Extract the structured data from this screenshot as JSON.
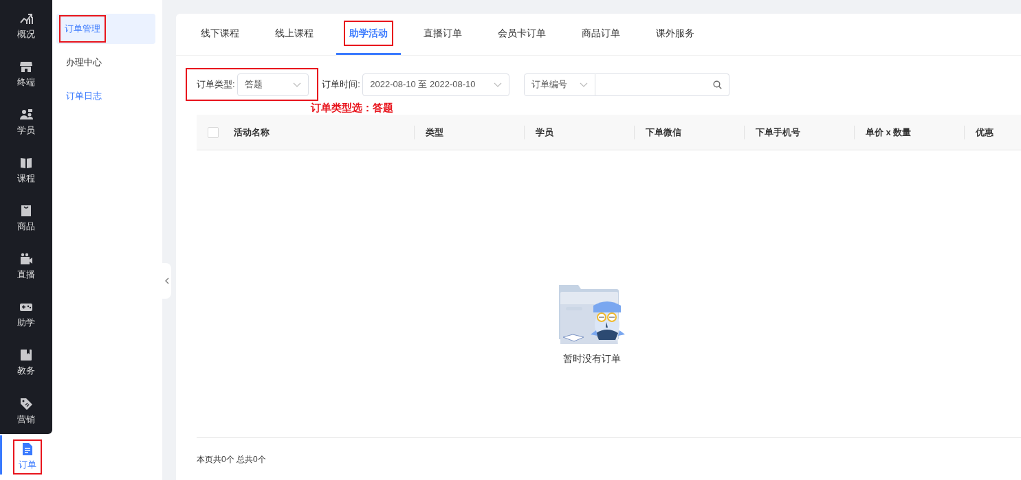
{
  "nav_rail": [
    {
      "label": "概况",
      "selected": false,
      "highlighted": false
    },
    {
      "label": "终端",
      "selected": false,
      "highlighted": false
    },
    {
      "label": "学员",
      "selected": false,
      "highlighted": false
    },
    {
      "label": "课程",
      "selected": false,
      "highlighted": false
    },
    {
      "label": "商品",
      "selected": false,
      "highlighted": false
    },
    {
      "label": "直播",
      "selected": false,
      "highlighted": false
    },
    {
      "label": "助学",
      "selected": false,
      "highlighted": false
    },
    {
      "label": "教务",
      "selected": false,
      "highlighted": false
    },
    {
      "label": "营销",
      "selected": false,
      "highlighted": false
    },
    {
      "label": "订单",
      "selected": true,
      "highlighted": true
    }
  ],
  "submenu": [
    {
      "label": "订单管理",
      "kind": "item",
      "selected": true,
      "highlighted": true
    },
    {
      "label": "办理中心",
      "kind": "item",
      "selected": false,
      "highlighted": false
    },
    {
      "label": "订单日志",
      "kind": "link",
      "selected": false,
      "highlighted": false
    }
  ],
  "tabs": [
    {
      "label": "线下课程",
      "selected": false,
      "highlighted": false
    },
    {
      "label": "线上课程",
      "selected": false,
      "highlighted": false
    },
    {
      "label": "助学活动",
      "selected": true,
      "highlighted": true
    },
    {
      "label": "直播订单",
      "selected": false,
      "highlighted": false
    },
    {
      "label": "会员卡订单",
      "selected": false,
      "highlighted": false
    },
    {
      "label": "商品订单",
      "selected": false,
      "highlighted": false
    },
    {
      "label": "课外服务",
      "selected": false,
      "highlighted": false
    }
  ],
  "filters": {
    "order_type": {
      "label": "订单类型:",
      "value": "答题",
      "highlighted": true
    },
    "order_time": {
      "label": "订单时间:",
      "value": "2022-08-10 至 2022-08-10"
    },
    "order_number": {
      "select": "订单编号"
    }
  },
  "annotation": "订单类型选：答题",
  "table": {
    "select_all_checked": false,
    "columns": [
      "活动名称",
      "类型",
      "学员",
      "下单微信",
      "下单手机号",
      "单价 x 数量",
      "优惠"
    ]
  },
  "empty_state": "暂时没有订单",
  "footer": "本页共0个 总共0个"
}
